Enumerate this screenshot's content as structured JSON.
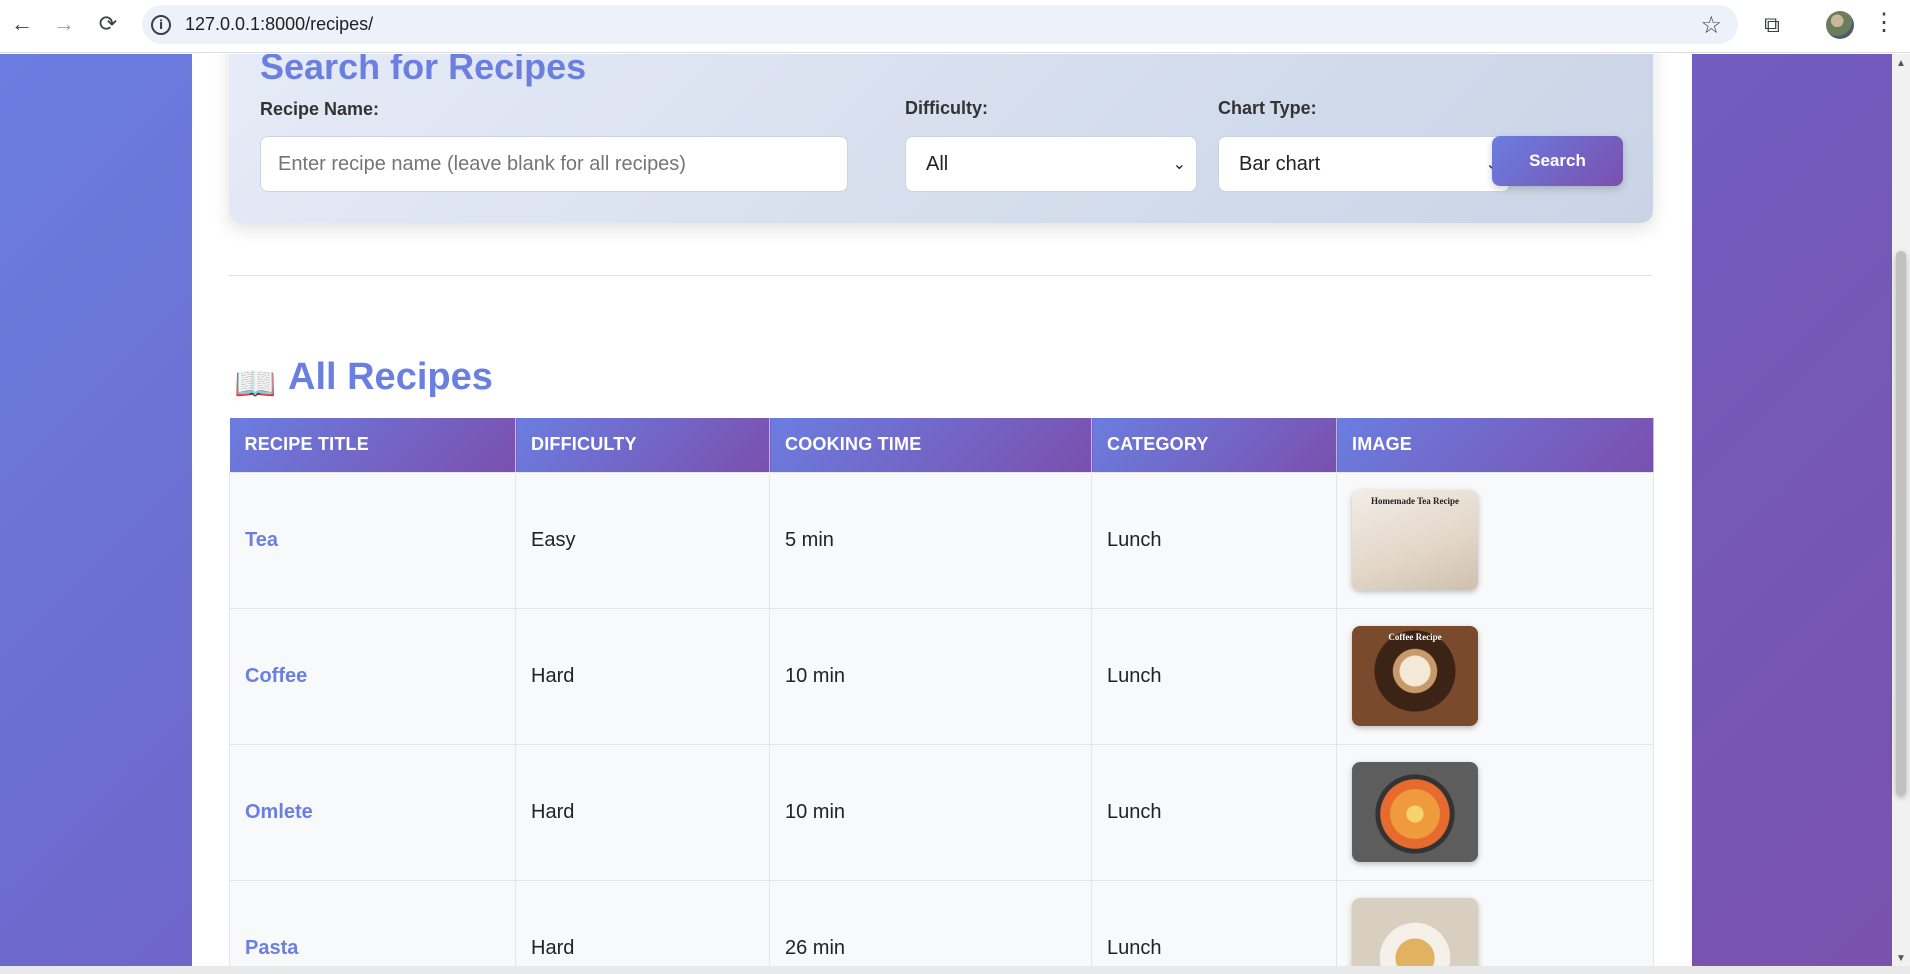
{
  "browser": {
    "url": "127.0.0.1:8000/recipes/"
  },
  "search": {
    "title": "Search for Recipes",
    "recipe_name_label": "Recipe Name:",
    "recipe_name_placeholder": "Enter recipe name (leave blank for all recipes)",
    "difficulty_label": "Difficulty:",
    "difficulty_value": "All",
    "chart_type_label": "Chart Type:",
    "chart_type_value": "Bar chart",
    "button_label": "Search"
  },
  "recipes_section": {
    "icon": "open-book-icon",
    "title": "All Recipes",
    "columns": [
      "RECIPE TITLE",
      "DIFFICULTY",
      "COOKING TIME",
      "CATEGORY",
      "IMAGE"
    ],
    "rows": [
      {
        "title": "Tea",
        "difficulty": "Easy",
        "cooking_time": "5 min",
        "category": "Lunch",
        "image_caption": "Homemade Tea Recipe"
      },
      {
        "title": "Coffee",
        "difficulty": "Hard",
        "cooking_time": "10 min",
        "category": "Lunch",
        "image_caption": "Coffee Recipe"
      },
      {
        "title": "Omlete",
        "difficulty": "Hard",
        "cooking_time": "10 min",
        "category": "Lunch",
        "image_caption": ""
      },
      {
        "title": "Pasta",
        "difficulty": "Hard",
        "cooking_time": "26 min",
        "category": "Lunch",
        "image_caption": ""
      }
    ]
  },
  "colors": {
    "accent": "#6b7fe0",
    "gradient_start": "#6a7ee0",
    "gradient_end": "#7b4fae"
  }
}
